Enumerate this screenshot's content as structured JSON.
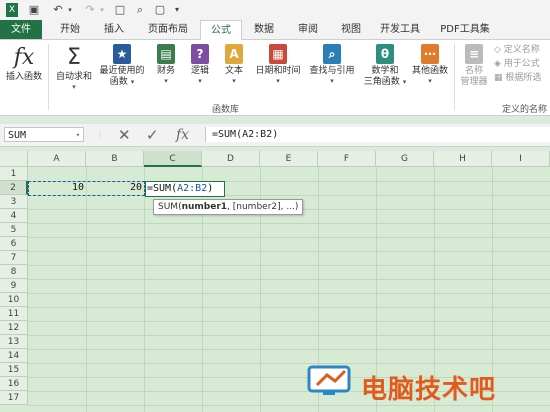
{
  "tabs": [
    "文件",
    "开始",
    "插入",
    "页面布局",
    "公式",
    "数据",
    "审阅",
    "视图",
    "开发工具",
    "PDF工具集"
  ],
  "active_tab": "公式",
  "ribbon": {
    "insert_function": "插入函数",
    "autosum": "自动求和",
    "recent_line1": "最近使用的",
    "recent_line2": "函数",
    "financial": "财务",
    "logical": "逻辑",
    "text": "文本",
    "datetime": "日期和时间",
    "lookup": "查找与引用",
    "math_line1": "数学和",
    "math_line2": "三角函数",
    "other": "其他函数",
    "group_label": "函数库",
    "name_manager_line1": "名称",
    "name_manager_line2": "管理器",
    "define_name": "定义名称",
    "use_in_formula": "用于公式",
    "create_from_selection": "根据所选",
    "defined_names_label": "定义的名称"
  },
  "formula_bar": {
    "name_box": "SUM",
    "formula": "=SUM(A2:B2)",
    "fx_label": "fx"
  },
  "columns": [
    "A",
    "B",
    "C",
    "D",
    "E",
    "F",
    "G",
    "H",
    "I"
  ],
  "rows": [
    "1",
    "2",
    "3",
    "4",
    "5",
    "6",
    "7",
    "8",
    "9",
    "10",
    "11",
    "12",
    "13",
    "14",
    "15",
    "16",
    "17"
  ],
  "cells": {
    "a2": "10",
    "b2": "20",
    "c2_prefix": "=SUM(",
    "c2_ref": "A2:B2",
    "c2_suffix": ")"
  },
  "tooltip": {
    "fn": "SUM(",
    "arg1": "number1",
    "rest": ", [number2], ...)"
  },
  "watermark": {
    "text": "电脑技术吧"
  },
  "colors": {
    "excel_green": "#217346",
    "sheet_bg": "#d6ead4",
    "ref_blue": "#1a57a7",
    "watermark": "#e25a1c"
  }
}
